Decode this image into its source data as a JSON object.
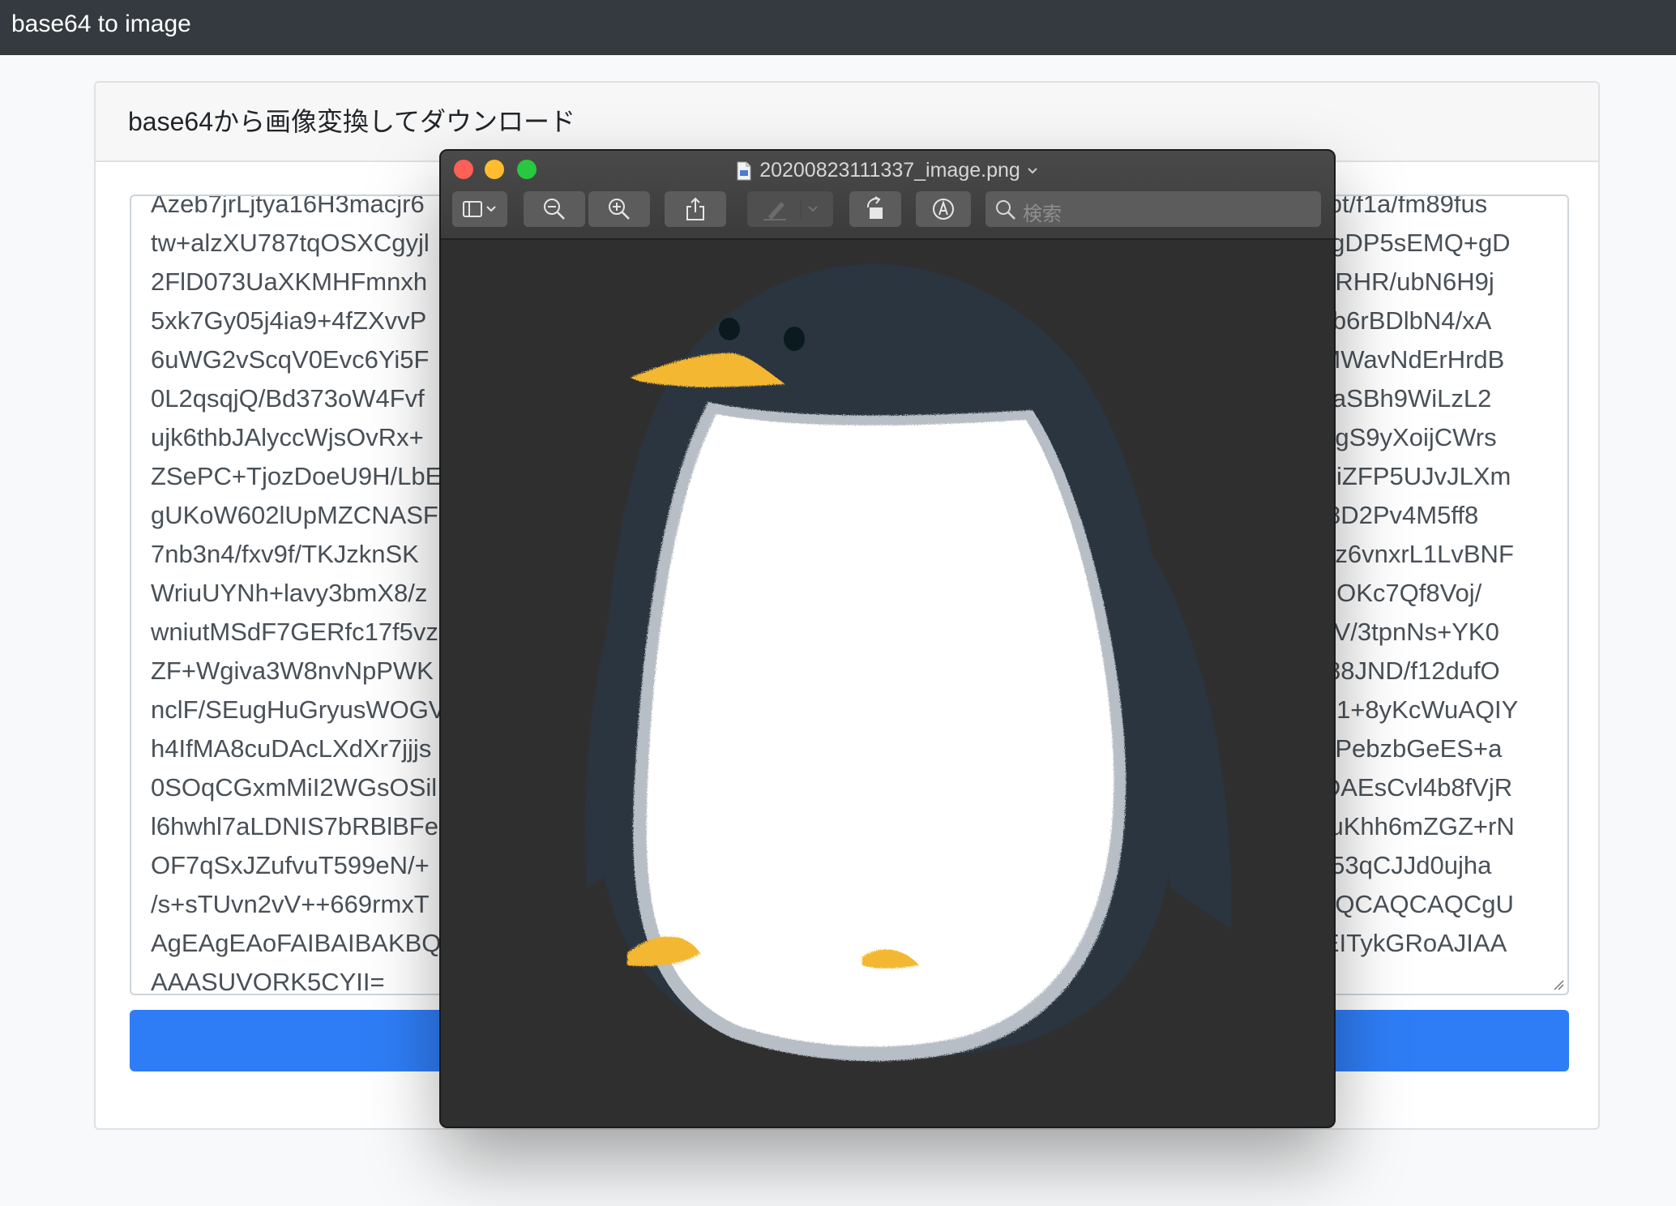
{
  "app": {
    "title": "base64 to image"
  },
  "card": {
    "header": "base64から画像変換してダウンロード",
    "textarea": {
      "left_lines": [
        "Azeb7jrLjtya16H3macjr6",
        "tw+alzXU787tqOSXCgyjl",
        "2FlD073UaXKMHFmnxh",
        "5xk7Gy05j4ia9+4fZXvvP",
        "6uWG2vScqV0Evc6Yi5F",
        "0L2qsqjQ/Bd373oW4Fvf",
        "ujk6thbJAlyccWjsOvRx+",
        "ZSePC+TjozDoeU9H/LbE",
        "gUKoW602lUpMZCNASF",
        "7nb3n4/fxv9f/TKJzknSK",
        "WriuUYNh+lavy3bmX8/z",
        "wniutMSdF7GERfc17f5vz",
        "ZF+Wgiva3W8nvNpPWK",
        "nclF/SEugHuGryusWOGV",
        "h4IfMA8cuDAcLXdXr7jjjs",
        "0SOqCGxmMiI2WGsOSil",
        "l6hwhl7aLDNIS7bRBlBFe",
        "OF7qSxJZufvuT599eN/+",
        "/s+sTUvn2vV++669rmxT",
        "AgEAgEAoFAIBAIBAKBQ",
        "AAASUVORK5CYII="
      ],
      "right_lines": [
        "J3bt/f1a/fm89fus",
        "dFgDP5sEMQ+gD",
        "APRHR/ubN6H9j",
        "X3b6rBDlbN4/xA",
        "CMWavNdErHrdB",
        "E9aSBh9WiLzL2",
        "quigS9yXoijCWrs",
        "ZOiZFP5UJvJLXm",
        "cx8D2Pv4M5ff8",
        "KPz6vnxrL1LvBNF",
        "ot2OKc7Qf8Voj/",
        "VZV/3tpnNs+YK0",
        "zz88JND/f12dufO",
        "3m1+8yKcWuAQIY",
        "J3fPebzbGeES+a",
        "MDAEsCvl4b8fVjR",
        "51uKhh6mZGZ+rN",
        "T353qCJJd0ujha",
        "KBQCAQCAQCgU",
        "3fEITykGRoAJIAA",
        ""
      ]
    },
    "button_label": ""
  },
  "preview": {
    "filename": "20200823111337_image.png",
    "search_placeholder": "検索",
    "icons": {
      "sidebar": "sidebar-toggle-icon",
      "zoom_out": "zoom-out-icon",
      "zoom_in": "zoom-in-icon",
      "share": "share-icon",
      "markup_pen": "markup-pen-icon",
      "rotate": "rotate-left-icon",
      "annotate": "markup-annotate-icon",
      "search": "search-icon"
    },
    "image": {
      "subject": "penguin illustration"
    }
  },
  "colors": {
    "navbar": "#343a40",
    "primary_button": "#2f7df6",
    "window_close": "#fe5f57",
    "window_minimize": "#febc2e",
    "window_maximize": "#28c840",
    "penguin_body": "#2c3440",
    "penguin_belly": "#ffffff",
    "penguin_beak": "#f4b733"
  }
}
